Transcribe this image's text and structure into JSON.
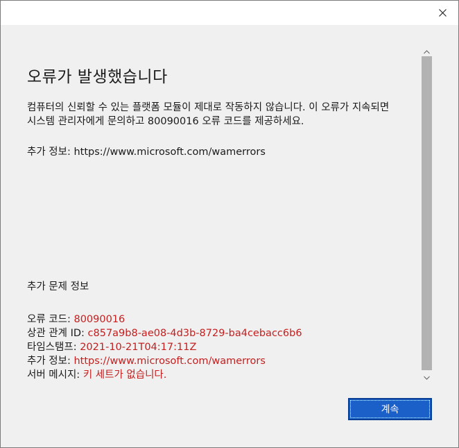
{
  "dialog": {
    "close_icon": "close-icon",
    "heading": "오류가 발생했습니다",
    "message_line1": "컴퓨터의 신뢰할 수 있는 플랫폼 모듈이 제대로 작동하지 않습니다. 이 오류가 지속되면",
    "message_line2": "시스템 관리자에게 문의하고 80090016 오류 코드를 제공하세요.",
    "more_info": "추가 정보: https://www.microsoft.com/wamerrors",
    "problem_heading": "추가 문제 정보",
    "details": {
      "error_code_label": "오류 코드: ",
      "error_code_value": "80090016",
      "correlation_label": "상관 관계 ID: ",
      "correlation_value": "c857a9b8-ae08-4d3b-8729-ba4cebacc6b6",
      "timestamp_label": "타임스탬프: ",
      "timestamp_value": "2021-10-21T04:17:11Z",
      "more_info_label": "추가 정보: ",
      "more_info_value": "https://www.microsoft.com/wamerrors",
      "server_message_label": "서버 메시지: ",
      "server_message_value": "키 세트가 없습니다."
    },
    "continue_label": "계속"
  },
  "colors": {
    "accent": "#1b5fc9",
    "error_value": "#c41e1e",
    "background": "#f0f0f0"
  }
}
